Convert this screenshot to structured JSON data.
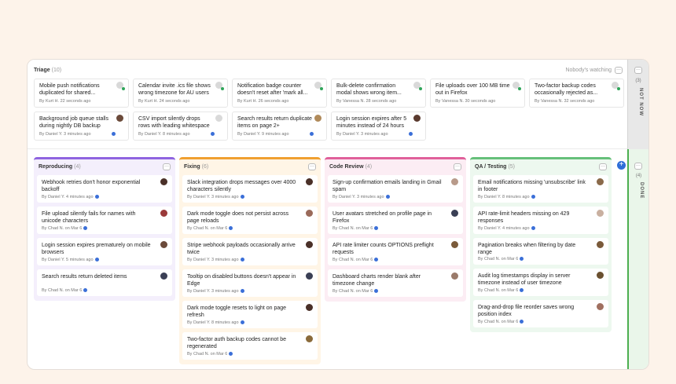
{
  "triage": {
    "title": "Triage",
    "count": "(10)",
    "watching": "Nobody's watching",
    "menu": "···",
    "cards": [
      {
        "title": "Mobile push notifications duplicated for shared...",
        "meta": "By Kurt H. 22 seconds ago",
        "avatar": "#d9d9d9"
      },
      {
        "title": "Calendar invite .ics file shows wrong timezone for AU users",
        "meta": "By Kurt H. 24 seconds ago",
        "avatar": "#d9d9d9"
      },
      {
        "title": "Notification badge counter doesn't reset after 'mark all...",
        "meta": "By Kurt H. 26 seconds ago",
        "avatar": "#d9d9d9"
      },
      {
        "title": "Bulk-delete confirmation modal shows wrong item...",
        "meta": "By Vanessa N. 28 seconds ago",
        "avatar": "#d9d9d9"
      },
      {
        "title": "File uploads over 100 MB time out in Firefox",
        "meta": "By Vanessa N. 30 seconds ago",
        "avatar": "#d9d9d9"
      },
      {
        "title": "Two-factor backup codes occasionally rejected as...",
        "meta": "By Vanessa N. 32 seconds ago",
        "avatar": "#d9d9d9"
      },
      {
        "title": "Background job queue stalls during nightly DB backup",
        "meta": "By Daniel Y. 3 minutes ago",
        "avatar": "#6b4a3a"
      },
      {
        "title": "CSV import silently drops rows with leading whitespace",
        "meta": "By Daniel Y. 8 minutes ago",
        "avatar": "#d9d9d9"
      },
      {
        "title": "Search results return duplicate items on page 2+",
        "meta": "By Daniel Y. 9 minutes ago",
        "avatar": "#b08a5a"
      },
      {
        "title": "Login session expires after 5 minutes instead of 24 hours",
        "meta": "By Daniel Y. 3 minutes ago",
        "avatar": "#5a3a2e"
      }
    ]
  },
  "side": {
    "not_now": {
      "count": "(3)",
      "label": "NOT NOW"
    },
    "done": {
      "count": "(4)",
      "label": "DONE"
    },
    "menu": "···"
  },
  "add_label": "+",
  "columns": [
    {
      "title": "Reproducing",
      "count": "(4)",
      "color": "#8f64e0",
      "bg": "#f4effc",
      "menu": "···",
      "cards": [
        {
          "title": "Webhook retries don't honor exponential backoff",
          "meta": "By Daniel Y. 4 minutes ago",
          "avatar": "#4a3028"
        },
        {
          "title": "File upload silently fails for names with unicode characters",
          "meta": "By Chad N. on Mar 6",
          "avatar": "#9a3a3a"
        },
        {
          "title": "Login session expires prematurely on mobile browsers",
          "meta": "By Daniel Y. 5 minutes ago",
          "avatar": "#6b4a3a"
        },
        {
          "title": "Search results return deleted items",
          "meta": "By Chad N. on Mar 6",
          "avatar": "#3a3f55"
        }
      ]
    },
    {
      "title": "Fixing",
      "count": "(6)",
      "color": "#f0a030",
      "bg": "#fff5e6",
      "menu": "···",
      "cards": [
        {
          "title": "Slack integration drops messages over 4000 characters silently",
          "meta": "By Daniel Y. 3 minutes ago",
          "avatar": "#4a3028"
        },
        {
          "title": "Dark mode toggle does not persist across page reloads",
          "meta": "By Chad N. on Mar 6",
          "avatar": "#9a6a5a"
        },
        {
          "title": "Stripe webhook payloads occasionally arrive twice",
          "meta": "By Daniel Y. 3 minutes ago",
          "avatar": "#4a3028"
        },
        {
          "title": "Tooltip on disabled buttons doesn't appear in Edge",
          "meta": "By Daniel Y. 3 minutes ago",
          "avatar": "#3a3f55"
        },
        {
          "title": "Dark mode toggle resets to light on page refresh",
          "meta": "By Daniel Y. 8 minutes ago",
          "avatar": "#4a3028"
        },
        {
          "title": "Two-factor auth backup codes cannot be regenerated",
          "meta": "By Chad N. on Mar 6",
          "avatar": "#8a6a3a"
        }
      ]
    },
    {
      "title": "Code Review",
      "count": "(4)",
      "color": "#e0609a",
      "bg": "#fcedf4",
      "menu": "···",
      "cards": [
        {
          "title": "Sign-up confirmation emails landing in Gmail spam",
          "meta": "By Daniel Y. 3 minutes ago",
          "avatar": "#b89a8a"
        },
        {
          "title": "User avatars stretched on profile page in Firefox",
          "meta": "By Chad N. on Mar 6",
          "avatar": "#3a3f55"
        },
        {
          "title": "API rate limiter counts OPTIONS preflight requests",
          "meta": "By Chad N. on Mar 6",
          "avatar": "#7a5a3a"
        },
        {
          "title": "Dashboard charts render blank after timezone change",
          "meta": "By Chad N. on Mar 6",
          "avatar": "#9a7a6a"
        }
      ]
    },
    {
      "title": "QA / Testing",
      "count": "(5)",
      "color": "#66c07a",
      "bg": "#edf8ef",
      "menu": "···",
      "cards": [
        {
          "title": "Email notifications missing 'unsubscribe' link in footer",
          "meta": "By Daniel Y. 8 minutes ago",
          "avatar": "#8a6a4a"
        },
        {
          "title": "API rate-limit headers missing on 429 responses",
          "meta": "By Daniel Y. 4 minutes ago",
          "avatar": "#c9b0a0"
        },
        {
          "title": "Pagination breaks when filtering by date range",
          "meta": "By Chad N. on Mar 6",
          "avatar": "#7a5a3a"
        },
        {
          "title": "Audit log timestamps display in server timezone instead of user timezone",
          "meta": "By Chad N. on Mar 6",
          "avatar": "#6a5030"
        },
        {
          "title": "Drag-and-drop file reorder saves wrong position index",
          "meta": "By Chad N. on Mar 6",
          "avatar": "#a07060"
        }
      ]
    }
  ]
}
